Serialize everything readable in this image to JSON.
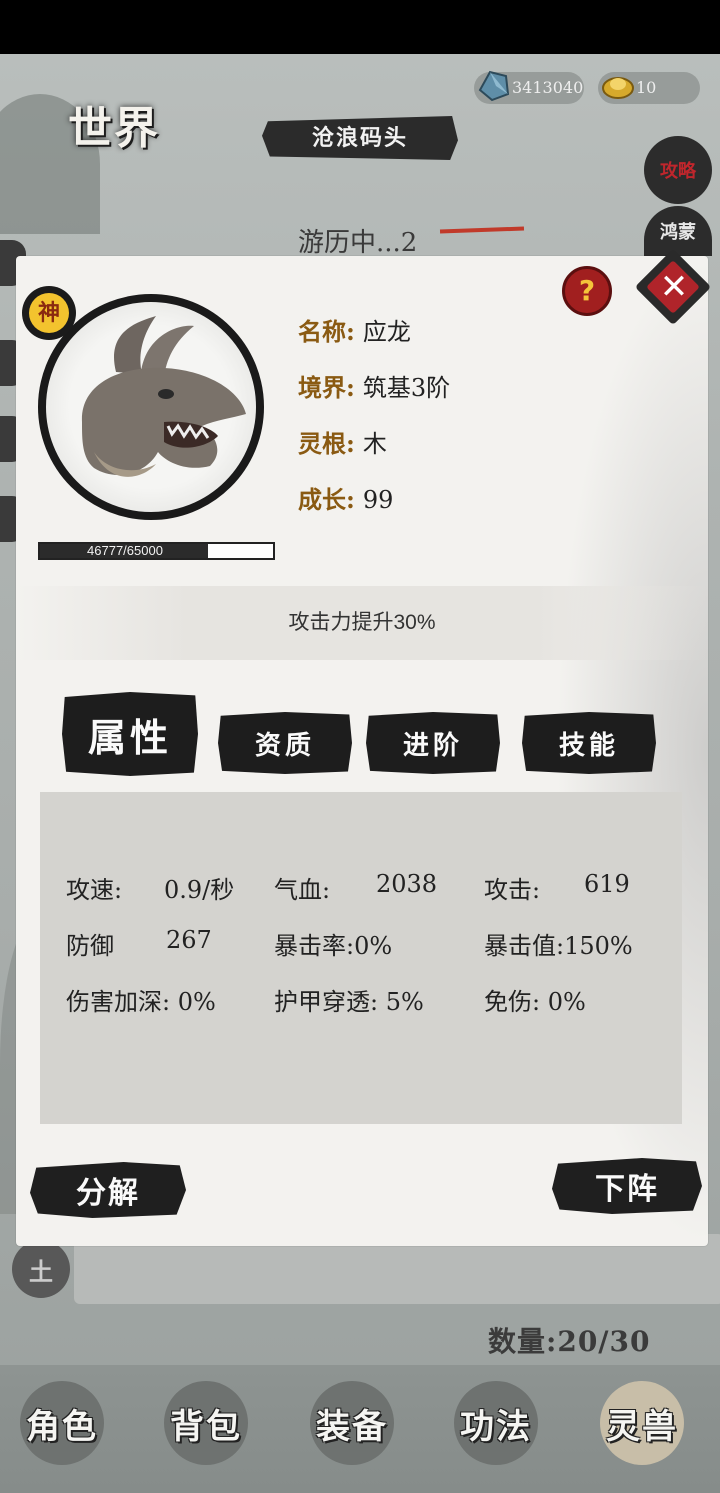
{
  "world": {
    "title": "世界"
  },
  "resources": [
    {
      "icon": "crystal-icon",
      "value": "3413040"
    },
    {
      "icon": "gold-ingot-icon",
      "value": "10"
    }
  ],
  "location": {
    "name": "沧浪码头"
  },
  "side_buttons": {
    "guide": "攻略",
    "hongmeng": "鸿蒙"
  },
  "status": {
    "traveling": "游历中...2"
  },
  "pet": {
    "rank": "神",
    "xp_text": "46777/65000",
    "xp_fraction": 0.7196,
    "fields": [
      {
        "key": "名称:",
        "value": "应龙"
      },
      {
        "key": "境界:",
        "value": "筑基3阶"
      },
      {
        "key": "灵根:",
        "value": "木"
      },
      {
        "key": "成长:",
        "value": "99"
      }
    ],
    "buff": "攻击力提升30%"
  },
  "tabs": [
    {
      "label": "属性",
      "active": true
    },
    {
      "label": "资质",
      "active": false
    },
    {
      "label": "进阶",
      "active": false
    },
    {
      "label": "技能",
      "active": false
    }
  ],
  "stats": [
    {
      "label": "攻速:",
      "value": "0.9/秒"
    },
    {
      "label": "气血:",
      "value": "2038"
    },
    {
      "label": "攻击:",
      "value": "619"
    },
    {
      "label": "防御",
      "value": "267"
    },
    {
      "label": "暴击率:",
      "value": "0%"
    },
    {
      "label": "暴击值:",
      "value": "150%"
    },
    {
      "label": "伤害加深:",
      "value": "0%"
    },
    {
      "label": "护甲穿透:",
      "value": "5%"
    },
    {
      "label": "免伤:",
      "value": "0%"
    }
  ],
  "actions": {
    "decompose": "分解",
    "unequip": "下阵"
  },
  "help_label": "?",
  "close_label": "✕",
  "element_badge": "土",
  "count": "数量:20/30",
  "nav": [
    {
      "label": "角色",
      "active": false
    },
    {
      "label": "背包",
      "active": false
    },
    {
      "label": "装备",
      "active": false
    },
    {
      "label": "功法",
      "active": false
    },
    {
      "label": "灵兽",
      "active": true
    }
  ],
  "colors": {
    "accent_red": "#a11f1f",
    "label_brown": "#8a5a12",
    "ink": "#1d1d1d",
    "rank_gold": "#f3c32e"
  }
}
